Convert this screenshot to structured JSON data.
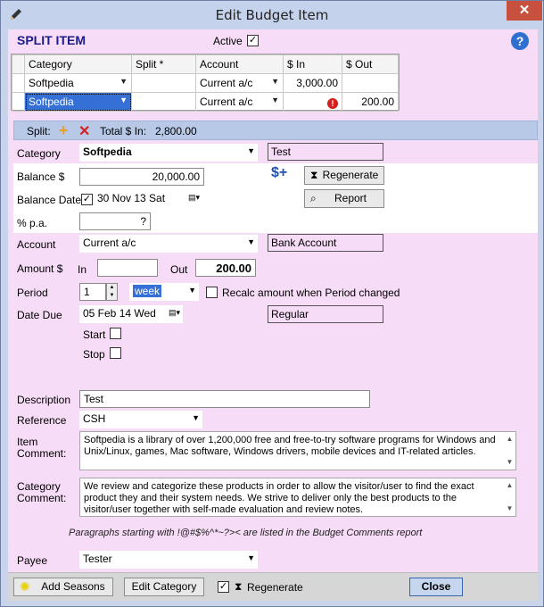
{
  "window": {
    "title": "Edit Budget Item",
    "close_glyph": "✕"
  },
  "header": {
    "title": "SPLIT ITEM",
    "active_label": "Active",
    "active_checked": "✓",
    "help_glyph": "?"
  },
  "grid": {
    "columns": [
      "",
      "Category",
      "Split *",
      "Account",
      "$ In",
      "$ Out"
    ],
    "rows": [
      {
        "category": "Softpedia",
        "split": "",
        "account": "Current a/c",
        "in": "3,000.00",
        "out": ""
      },
      {
        "category": "Softpedia",
        "split": "",
        "account": "Current a/c",
        "in": "",
        "out": "200.00"
      }
    ]
  },
  "split_bar": {
    "label": "Split:",
    "add_glyph": "+",
    "delete_glyph": "✕",
    "total_label": "Total $ In:",
    "total_value": "2,800.00"
  },
  "form": {
    "category_label": "Category",
    "category_value": "Softpedia",
    "category_note": "Test",
    "balance_label": "Balance $",
    "balance_value": "20,000.00",
    "regenerate_label": "Regenerate",
    "balance_date_label": "Balance Date",
    "balance_date_value": "30 Nov 13  Sat",
    "report_label": "Report",
    "pa_label": "% p.a.",
    "pa_value": "?",
    "account_label": "Account",
    "account_value": "Current a/c",
    "account_note": "Bank Account",
    "amount_label": "Amount $",
    "in_label": "In",
    "in_value": "",
    "out_label": "Out",
    "out_value": "200.00",
    "period_label": "Period",
    "period_value": "1",
    "period_unit": "week",
    "recalc_label": "Recalc amount when Period changed",
    "date_due_label": "Date Due",
    "date_due_value": "05 Feb 14 Wed",
    "date_due_note": "Regular",
    "start_label": "Start",
    "stop_label": "Stop",
    "description_label": "Description",
    "description_value": "Test",
    "reference_label": "Reference",
    "reference_value": "CSH",
    "item_comment_label_1": "Item",
    "item_comment_label_2": "Comment:",
    "item_comment_value": "Softpedia is a library of over 1,200,000 free and free-to-try software programs for Windows and Unix/Linux, games, Mac software, Windows drivers, mobile devices and IT-related articles.",
    "category_comment_label_1": "Category",
    "category_comment_label_2": "Comment:",
    "category_comment_value": "We review and categorize these products in order to allow the visitor/user to find the exact product they and their system needs. We strive to deliver only the best products to the visitor/user together with self-made evaluation and review notes.",
    "paragraph_note": "Paragraphs starting with  !@#$%^*~?><  are listed in the Budget Comments report",
    "payee_label": "Payee",
    "payee_value": "Tester"
  },
  "footer": {
    "add_seasons_label": "Add Seasons",
    "edit_category_label": "Edit Category",
    "regenerate_checked": "✓",
    "regenerate_label": "Regenerate",
    "close_label": "Close"
  },
  "colors": {
    "client_bg": "#f6dcf6",
    "title_blue": "#1c1c8a",
    "selection": "#3470d6"
  }
}
